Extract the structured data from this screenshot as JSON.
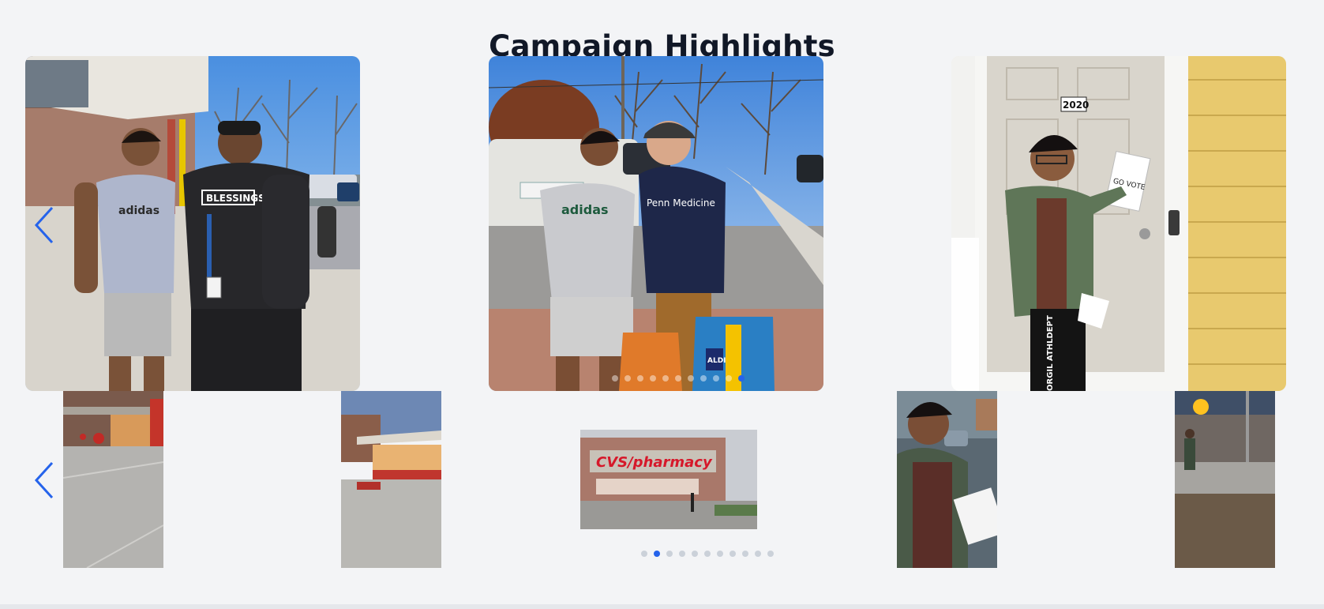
{
  "section": {
    "title": "Campaign Highlights"
  },
  "carousel_top": {
    "slides": [
      {
        "shirt_text": "adidas",
        "hoodie_text": "BLESSINGS"
      },
      {
        "shirt_text": "adidas",
        "hoodie_text": "Penn Medicine",
        "bag_text": "ALDI"
      },
      {
        "door_number": "2020",
        "flyer_text": "GO VOTE",
        "pants_text": "ORGIL ATHLDEPT"
      }
    ],
    "prev_icon": "chevron-left-icon",
    "dot_count": 11,
    "active_dot": 11
  },
  "carousel_bottom": {
    "center_sign": "CVS/pharmacy",
    "prev_icon": "chevron-left-icon",
    "dot_count": 11,
    "active_dot": 2
  },
  "colors": {
    "accent": "#2563eb",
    "background": "#f3f4f6",
    "title": "#111827"
  }
}
